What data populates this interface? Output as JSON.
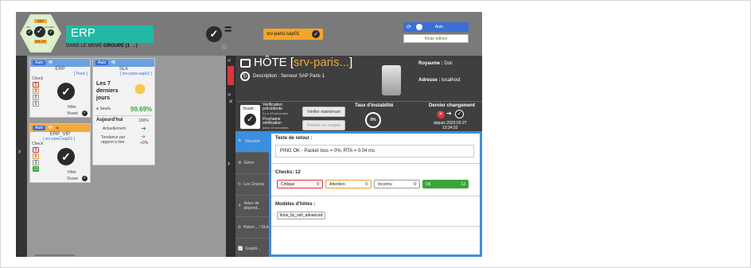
{
  "header": {
    "hex_badge": {
      "title": "ERP",
      "left_label": "Paris",
      "right_label": "erp-paris",
      "bottom_label": "ERP_VIP"
    },
    "name": "ERP",
    "subtitle_prefix": "DANS LE MEME",
    "subtitle_strong": "GROUPE (1 →)",
    "equals": "=",
    "server_pill": "srv-paris-sap01",
    "auto_label": "Auto",
    "mode_label": "Mode édition"
  },
  "cards": {
    "erp": {
      "auto": "Auto",
      "title": "ERP",
      "sub": "[ Paris ]",
      "check_label": "Check",
      "counts": [
        "0",
        "0",
        "0",
        "0"
      ],
      "type": "Hôte",
      "status": "Vivant"
    },
    "sla": {
      "auto": "Auto",
      "title": "SLA",
      "sub": "[ srv-paris-sap01 ]",
      "period": "Les 7 derniers jours",
      "seuils": "Seuils",
      "pct": "99.69%",
      "today": "Aujourd'hui",
      "today_pct": "100%",
      "now": "Actuellement",
      "trend": "Tendance par rapport à hier",
      "trend_pct": "+0%"
    },
    "vip": {
      "auto": "Auto",
      "title": "ERP_VIP",
      "sub": "[ srv-paris-sap01 ]",
      "check_label": "Check",
      "counts": [
        "0",
        "0",
        "0",
        "12"
      ],
      "type": "Hôte",
      "status": "Vivant"
    }
  },
  "host": {
    "prefix": "HÔTE [",
    "name": "srv-paris...",
    "suffix": "]",
    "description": "Description : Serveur SAP Paris 1",
    "royaume_label": "Royaume :",
    "royaume": "Doc",
    "adresse_label": "Adresse :",
    "adresse": "localhost",
    "vivant": "Vivant :",
    "verif_prev": "Vérification précédente",
    "verif_prev_time": "il y a 43 secondes",
    "verif_next": "Prochaine vérification",
    "verif_next_time": "dans 13 secondes",
    "verify_now": "Vérifier maintenant",
    "acknowledge": "Prendre en compte",
    "instab_label": "Taux d'instabilité",
    "instab_value": "0%",
    "last_change_label": "Dernier changement",
    "last_change_since": "depuis 2023-02-27",
    "last_change_time": "13:24:32"
  },
  "nav": [
    {
      "label": "Résumé",
      "icon": "search-icon"
    },
    {
      "label": "Gérer",
      "icon": "gear-icon"
    },
    {
      "label": "Les Checks",
      "icon": "refresh-icon"
    },
    {
      "label": "Arbre de dépend...",
      "icon": "tree-icon"
    },
    {
      "label": "Histori... / SLA",
      "icon": "history-icon"
    },
    {
      "label": "Graphi...",
      "icon": "chart-icon"
    }
  ],
  "content": {
    "return_label": "Texte de retour :",
    "return_text": "PING OK - Packet loss = 0%, RTA = 0.04 ms",
    "checks_label": "Checks: 12",
    "stats": [
      {
        "label": "Critique",
        "value": "0"
      },
      {
        "label": "Attention",
        "value": "0"
      },
      {
        "label": "Inconnu",
        "value": "0"
      },
      {
        "label": "Ok",
        "value": "12"
      }
    ],
    "models_label": "Modèles d'hôtes :",
    "model_tag": "linux_by_ssh_advanced"
  },
  "colors": {
    "accent": "#3b8fe0",
    "ok": "#3ba53b",
    "warning": "#f1a93c",
    "critical": "#d9363e",
    "teal": "#22b8a6"
  }
}
